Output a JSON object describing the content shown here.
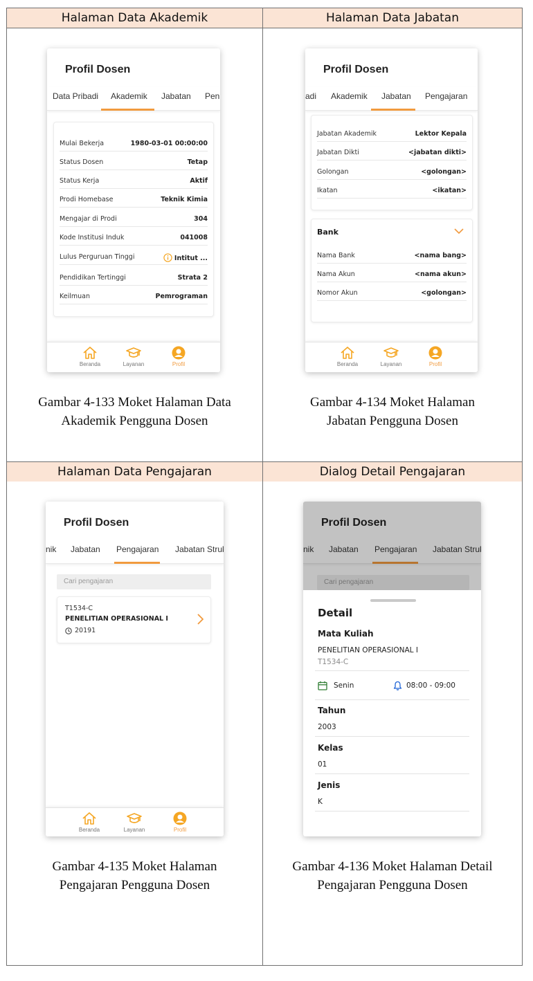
{
  "headers": {
    "academic": "Halaman Data Akademik",
    "position": "Halaman Data Jabatan",
    "teaching": "Halaman Data Pengajaran",
    "dialog": "Dialog Detail Pengajaran"
  },
  "captions": {
    "academic": [
      "Gambar 4-133 Moket Halaman Data",
      "Akademik Pengguna Dosen"
    ],
    "position": [
      "Gambar 4-134 Moket Halaman",
      "Jabatan Pengguna Dosen"
    ],
    "teaching": [
      "Gambar 4-135 Moket Halaman",
      "Pengajaran Pengguna Dosen"
    ],
    "dialog": [
      "Gambar 4-136 Moket Halaman Detail",
      "Pengajaran Pengguna Dosen"
    ]
  },
  "app_title": "Profil Dosen",
  "nav": {
    "home": "Beranda",
    "services": "Layanan",
    "profile": "Profil",
    "accent": "#f19a3e",
    "icon_color": "#f5a623"
  },
  "screen1": {
    "tabs": [
      "Data Pribadi",
      "Akademik",
      "Jabatan",
      "Pen"
    ],
    "fields": [
      {
        "label": "Mulai Bekerja",
        "value": "1980-03-01 00:00:00"
      },
      {
        "label": "Status Dosen",
        "value": "Tetap"
      },
      {
        "label": "Status Kerja",
        "value": "Aktif"
      },
      {
        "label": "Prodi Homebase",
        "value": "Teknik Kimia"
      },
      {
        "label": "Mengajar di Prodi",
        "value": "304"
      },
      {
        "label": "Kode Institusi Induk",
        "value": "041008"
      },
      {
        "label": "Lulus Perguruan Tinggi",
        "value": "Intitut ..."
      },
      {
        "label": "Pendidikan Tertinggi",
        "value": "Strata 2"
      },
      {
        "label": "Keilmuan",
        "value": "Pemrograman"
      }
    ]
  },
  "screen2": {
    "tabs": [
      "adi",
      "Akademik",
      "Jabatan",
      "Pengajaran"
    ],
    "fields": [
      {
        "label": "Jabatan Akademik",
        "value": "Lektor Kepala"
      },
      {
        "label": "Jabatan Dikti",
        "value": "<jabatan dikti>"
      },
      {
        "label": "Golongan",
        "value": "<golongan>"
      },
      {
        "label": "Ikatan",
        "value": "<ikatan>"
      }
    ],
    "bank_title": "Bank",
    "bank_fields": [
      {
        "label": "Nama Bank",
        "value": "<nama bang>"
      },
      {
        "label": "Nama Akun",
        "value": "<nama akun>"
      },
      {
        "label": "Nomor Akun",
        "value": "<golongan>"
      }
    ]
  },
  "screen3": {
    "tabs": [
      "nik",
      "Jabatan",
      "Pengajaran",
      "Jabatan Struk"
    ],
    "search_placeholder": "Cari pengajaran",
    "item": {
      "code": "T1534-C",
      "name": "PENELITIAN OPERASIONAL I",
      "term": "20191"
    }
  },
  "screen4": {
    "tabs": [
      "nik",
      "Jabatan",
      "Pengajaran",
      "Jabatan Struk"
    ],
    "search_placeholder": "Cari pengajaran",
    "detail_title": "Detail",
    "course_label": "Mata Kuliah",
    "course_name": "PENELITIAN OPERASIONAL I",
    "course_code": "T1534-C",
    "day": "Senin",
    "time": "08:00 - 09:00",
    "year_label": "Tahun",
    "year": "2003",
    "class_label": "Kelas",
    "class": "01",
    "type_label": "Jenis",
    "type": "K"
  }
}
